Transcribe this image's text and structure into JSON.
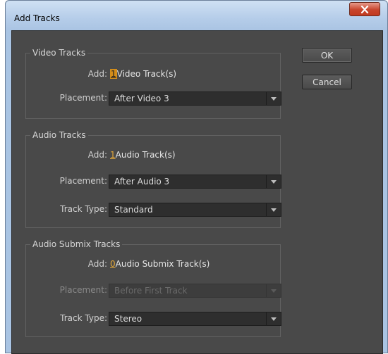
{
  "window": {
    "title": "Add Tracks"
  },
  "buttons": {
    "ok": "OK",
    "cancel": "Cancel"
  },
  "video": {
    "legend": "Video Tracks",
    "add_label": "Add:",
    "add_count": "1",
    "add_unit": "Video Track(s)",
    "placement_label": "Placement:",
    "placement_value": "After Video 3"
  },
  "audio": {
    "legend": "Audio Tracks",
    "add_label": "Add:",
    "add_count": "1",
    "add_unit": "Audio Track(s)",
    "placement_label": "Placement:",
    "placement_value": "After Audio 3",
    "track_type_label": "Track Type:",
    "track_type_value": "Standard"
  },
  "submix": {
    "legend": "Audio Submix Tracks",
    "add_label": "Add:",
    "add_count": "0",
    "add_unit": "Audio Submix Track(s)",
    "placement_label": "Placement:",
    "placement_value": "Before First Track",
    "placement_disabled": true,
    "track_type_label": "Track Type:",
    "track_type_value": "Stereo"
  },
  "colors": {
    "panel_bg": "#494949",
    "accent_orange": "#e3a83a",
    "focus_highlight": "#d38d1a",
    "titlebar_blue": "#aac4e3",
    "close_red": "#c8452c"
  }
}
